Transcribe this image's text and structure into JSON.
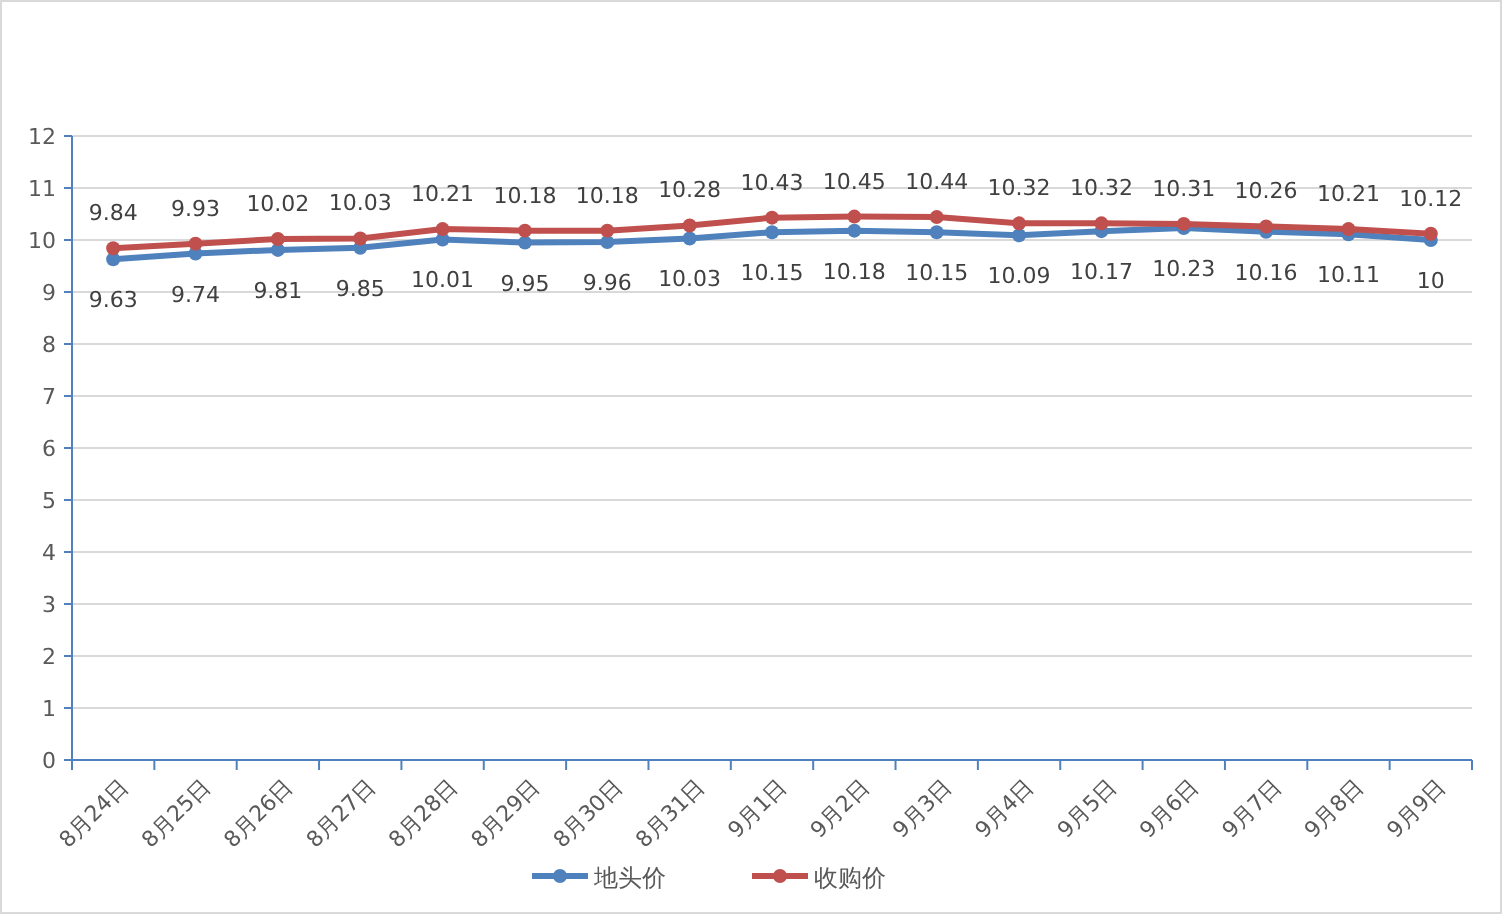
{
  "chart_data": {
    "type": "line",
    "categories": [
      "8月24日",
      "8月25日",
      "8月26日",
      "8月27日",
      "8月28日",
      "8月29日",
      "8月30日",
      "8月31日",
      "9月1日",
      "9月2日",
      "9月3日",
      "9月4日",
      "9月5日",
      "9月6日",
      "9月7日",
      "9月8日",
      "9月9日"
    ],
    "grid": true,
    "legend": "bottom",
    "ylim": [
      0,
      12
    ],
    "yticks": [
      0,
      1,
      2,
      3,
      4,
      5,
      6,
      7,
      8,
      9,
      10,
      11,
      12
    ],
    "data_labels": true,
    "series": [
      {
        "name": "地头价",
        "color": "#4f81bd",
        "marker": "circle",
        "values": [
          9.63,
          9.74,
          9.81,
          9.85,
          10.01,
          9.95,
          9.96,
          10.03,
          10.15,
          10.18,
          10.15,
          10.09,
          10.17,
          10.23,
          10.16,
          10.11,
          10
        ]
      },
      {
        "name": "收购价",
        "color": "#c0504d",
        "marker": "circle",
        "values": [
          9.84,
          9.93,
          10.02,
          10.03,
          10.21,
          10.18,
          10.18,
          10.28,
          10.43,
          10.45,
          10.44,
          10.32,
          10.32,
          10.31,
          10.26,
          10.21,
          10.12
        ]
      }
    ]
  }
}
